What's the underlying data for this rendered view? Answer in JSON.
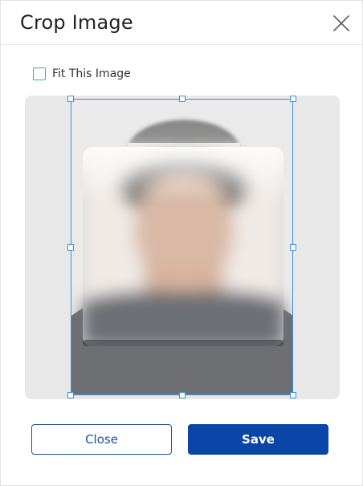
{
  "dialog": {
    "title": "Crop Image",
    "close_icon": "close-icon"
  },
  "options": {
    "fit_label": "Fit This Image",
    "fit_checked": false
  },
  "crop": {
    "image_alt": "blurred portrait photo"
  },
  "footer": {
    "close_label": "Close",
    "save_label": "Save"
  },
  "colors": {
    "accent": "#0a45a8",
    "crop_frame": "#3b8ee8",
    "checkbox_border": "#29b3a6"
  }
}
